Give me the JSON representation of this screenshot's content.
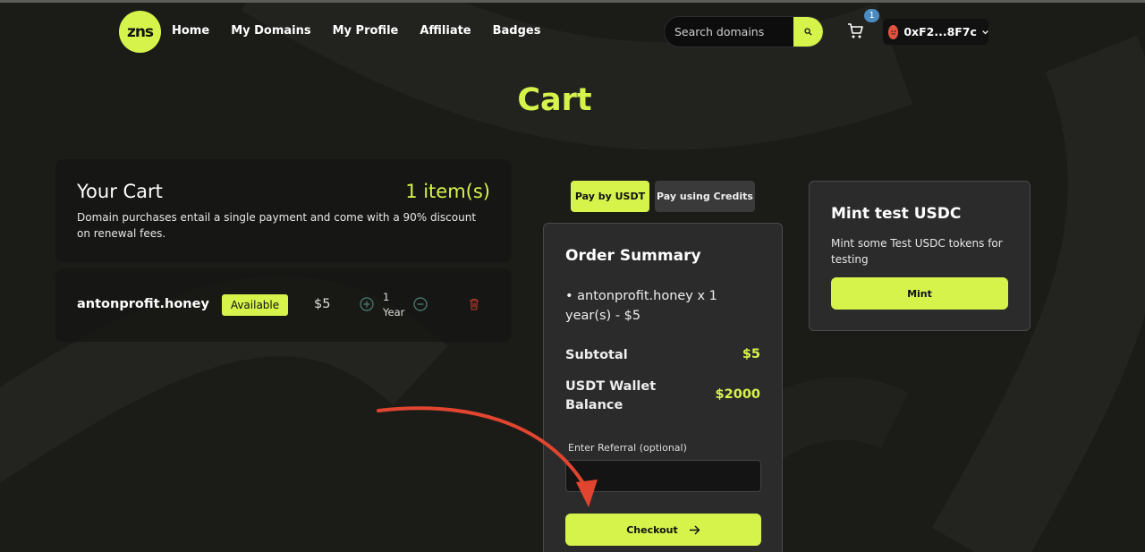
{
  "brand": {
    "logo_text": "zns"
  },
  "nav": {
    "items": [
      "Home",
      "My Domains",
      "My Profile",
      "Affiliate",
      "Badges"
    ]
  },
  "search": {
    "placeholder": "Search domains",
    "button_icon": "search-icon"
  },
  "cart": {
    "badge_count": "1",
    "icon": "cart-icon"
  },
  "wallet": {
    "address": "0xF2...8F7c",
    "icon": "chevron-down-icon"
  },
  "page": {
    "title": "Cart"
  },
  "your_cart": {
    "title": "Your Cart",
    "count": "1 item(s)",
    "description": "Domain purchases entail a single payment and come with a 90% discount on renewal fees."
  },
  "items": [
    {
      "domain": "antonprofit.honey",
      "status": "Available",
      "price": "$5",
      "qty": "1",
      "unit": "Year"
    }
  ],
  "payment_tabs": {
    "usdt": "Pay by USDT",
    "credits": "Pay using Credits"
  },
  "summary": {
    "title": "Order Summary",
    "line_item": "• antonprofit.honey x 1 year(s) - $5",
    "subtotal_label": "Subtotal",
    "subtotal_value": "$5",
    "balance_label": "USDT Wallet Balance",
    "balance_value": "$2000",
    "referral_label": "Enter Referral (optional)",
    "referral_value": "",
    "checkout_label": "Checkout"
  },
  "mint": {
    "title": "Mint test USDC",
    "description": "Mint some Test USDC tokens for testing",
    "button_label": "Mint"
  },
  "colors": {
    "accent": "#d6f34c",
    "background": "#1b1c18",
    "annotation_arrow": "#e2452f"
  }
}
